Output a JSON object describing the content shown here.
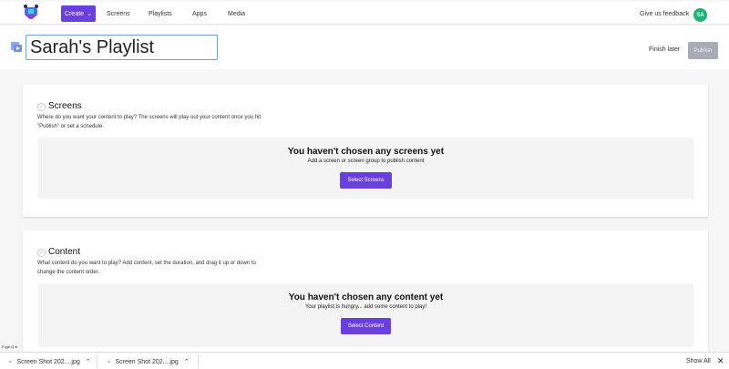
{
  "nav": {
    "create": "Create",
    "links": [
      "Screens",
      "Playlists",
      "Apps",
      "Media"
    ],
    "feedback": "Give us feedback",
    "avatar": "SA"
  },
  "header": {
    "title": "Sarah's Playlist",
    "finish_later": "Finish later",
    "publish": "Publish"
  },
  "screens": {
    "title": "Screens",
    "description": "Where do you want your content to play? The screens will play out your content once you hit \"Publish\" or set a schedule.",
    "empty_title": "You haven't chosen any screens yet",
    "empty_sub": "Add a screen or screen group to publish content",
    "button": "Select Screens"
  },
  "content": {
    "title": "Content",
    "description": "What content do you want to play? Add content, set the duration, and drag it up or down to change the content order.",
    "empty_title": "You haven't chosen any content yet",
    "empty_sub": "Your playlist is hungry... add some content to play!",
    "button": "Select Content"
  },
  "status": "Fuge Q ●",
  "downloads": {
    "items": [
      "Screen Shot 202....jpg",
      "Screen Shot 202....jpg"
    ],
    "show_all": "Show All"
  },
  "colors": {
    "accent": "#6a3fe0",
    "avatar": "#1eb374"
  }
}
